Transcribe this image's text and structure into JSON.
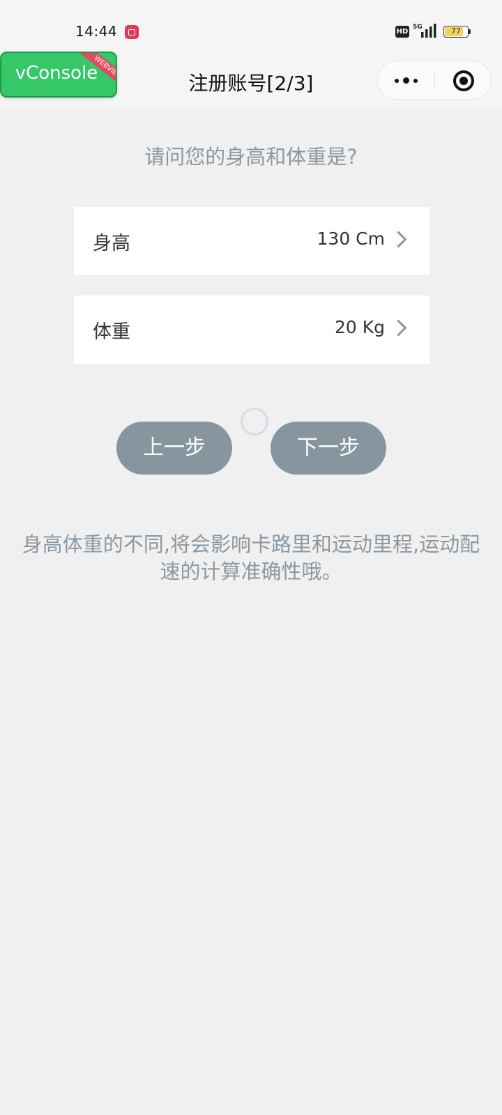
{
  "status_bar": {
    "time": "14:44",
    "battery": "77",
    "network": "5G"
  },
  "nav": {
    "title": "注册账号[2/3]",
    "more_icon": "more-dots-icon",
    "close_icon": "target-close-icon"
  },
  "vconsole": {
    "label": "vConsole",
    "ribbon": "WEBVIEW"
  },
  "question": "请问您的身高和体重是?",
  "fields": [
    {
      "label": "身高",
      "value": "130 Cm"
    },
    {
      "label": "体重",
      "value": "20 Kg"
    }
  ],
  "buttons": {
    "prev": "上一步",
    "next": "下一步"
  },
  "hint": "身高体重的不同,将会影响卡路里和运动里程,运动配速的计算准确性哦。",
  "colors": {
    "accent_gray": "#87959f",
    "text_gray": "#8a98a3",
    "vconsole_green": "#35c768"
  }
}
